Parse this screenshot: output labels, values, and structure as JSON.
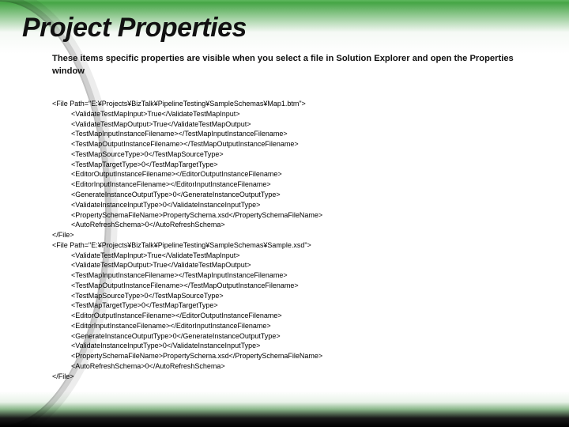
{
  "title": "Project Properties",
  "subtitle": "These items specific properties are visible when you select a file in Solution Explorer and open the Properties window",
  "xml": {
    "files": [
      {
        "open": "<File Path=\"E:¥Projects¥BizTalk¥PipelineTesting¥SampleSchemas¥Map1.btm\">",
        "children": [
          "<ValidateTestMapInput>True</ValidateTestMapInput>",
          "<ValidateTestMapOutput>True</ValidateTestMapOutput>",
          "<TestMapInputInstanceFilename></TestMapInputInstanceFilename>",
          "<TestMapOutputInstanceFilename></TestMapOutputInstanceFilename>",
          "<TestMapSourceType>0</TestMapSourceType>",
          "<TestMapTargetType>0</TestMapTargetType>",
          "<EditorOutputInstanceFilename></EditorOutputInstanceFilename>",
          "<EditorInputInstanceFilename></EditorInputInstanceFilename>",
          "<GenerateInstanceOutputType>0</GenerateInstanceOutputType>",
          "<ValidateInstanceInputType>0</ValidateInstanceInputType>",
          "<PropertySchemaFileName>PropertySchema.xsd</PropertySchemaFileName>",
          "<AutoRefreshSchema>0</AutoRefreshSchema>"
        ],
        "close": "</File>"
      },
      {
        "open": "<File Path=\"E:¥Projects¥BizTalk¥PipelineTesting¥SampleSchemas¥Sample.xsd\">",
        "children": [
          "<ValidateTestMapInput>True</ValidateTestMapInput>",
          "<ValidateTestMapOutput>True</ValidateTestMapOutput>",
          "<TestMapInputInstanceFilename></TestMapInputInstanceFilename>",
          "<TestMapOutputInstanceFilename></TestMapOutputInstanceFilename>",
          "<TestMapSourceType>0</TestMapSourceType>",
          "<TestMapTargetType>0</TestMapTargetType>",
          "<EditorOutputInstanceFilename></EditorOutputInstanceFilename>",
          "<EditorInputInstanceFilename></EditorInputInstanceFilename>",
          "<GenerateInstanceOutputType>0</GenerateInstanceOutputType>",
          "<ValidateInstanceInputType>0</ValidateInstanceInputType>",
          "<PropertySchemaFileName>PropertySchema.xsd</PropertySchemaFileName>",
          "<AutoRefreshSchema>0</AutoRefreshSchema>"
        ],
        "close": "</File>"
      }
    ]
  }
}
